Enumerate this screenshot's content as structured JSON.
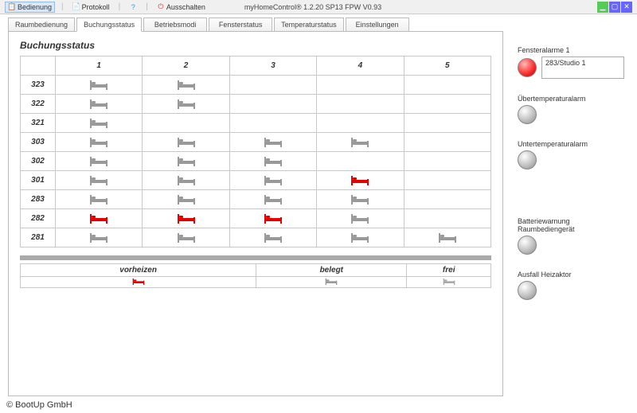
{
  "toolbar": {
    "bedienung": "Bedienung",
    "protokoll": "Protokoll",
    "help": "",
    "ausschalten": "Ausschalten",
    "title": "myHomeControl®  1.2.20 SP13        FPW V0.93"
  },
  "tabs": {
    "raumbedienung": "Raumbedienung",
    "buchungsstatus": "Buchungsstatus",
    "betriebsmodi": "Betriebsmodi",
    "fensterstatus": "Fensterstatus",
    "temperaturstatus": "Temperaturstatus",
    "einstellungen": "Einstellungen"
  },
  "panel": {
    "title": "Buchungsstatus",
    "columns": [
      "1",
      "2",
      "3",
      "4",
      "5"
    ],
    "rooms": [
      {
        "id": "323",
        "cells": [
          "gray",
          "gray",
          "",
          "",
          ""
        ]
      },
      {
        "id": "322",
        "cells": [
          "gray",
          "gray",
          "",
          "",
          ""
        ]
      },
      {
        "id": "321",
        "cells": [
          "gray",
          "",
          "",
          "",
          ""
        ]
      },
      {
        "id": "303",
        "cells": [
          "gray",
          "gray",
          "gray",
          "gray",
          ""
        ]
      },
      {
        "id": "302",
        "cells": [
          "gray",
          "gray",
          "gray",
          "",
          ""
        ]
      },
      {
        "id": "301",
        "cells": [
          "gray",
          "gray",
          "gray",
          "red",
          ""
        ]
      },
      {
        "id": "283",
        "cells": [
          "gray",
          "gray",
          "gray",
          "gray",
          ""
        ]
      },
      {
        "id": "282",
        "cells": [
          "red",
          "red",
          "red",
          "gray",
          ""
        ]
      },
      {
        "id": "281",
        "cells": [
          "gray",
          "gray",
          "gray",
          "gray",
          "gray"
        ]
      }
    ],
    "legend": {
      "vorheizen": "vorheizen",
      "belegt": "belegt",
      "frei": "frei"
    }
  },
  "alarms": {
    "fensteralarm": {
      "label": "Fensteralarme 1",
      "text": "283/Studio 1"
    },
    "uebertemperatur": {
      "label": "Übertemperaturalarm"
    },
    "untertemperatur": {
      "label": "Untertemperaturalarm"
    },
    "batterie": {
      "label": "Batteriewarnung Raumbediengerät"
    },
    "ausfall": {
      "label": "Ausfall Heizaktor"
    }
  },
  "footer": "© BootUp GmbH"
}
